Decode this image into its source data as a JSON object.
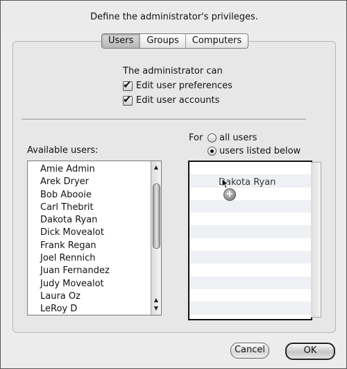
{
  "dialog": {
    "title": "Define the administrator's privileges."
  },
  "tabs": [
    {
      "label": "Users",
      "selected": true
    },
    {
      "label": "Groups",
      "selected": false
    },
    {
      "label": "Computers",
      "selected": false
    }
  ],
  "privileges": {
    "heading": "The administrator can",
    "options": [
      {
        "label": "Edit user preferences",
        "checked": true
      },
      {
        "label": "Edit user accounts",
        "checked": true
      }
    ]
  },
  "scope": {
    "label": "For",
    "options": [
      {
        "label": "all users",
        "selected": false
      },
      {
        "label": "users listed below",
        "selected": true
      }
    ]
  },
  "available_users": {
    "label": "Available users:",
    "items": [
      "Amie Admin",
      "Arek Dryer",
      "Bob Abooie",
      "Carl Thebrit",
      "Dakota Ryan",
      "Dick Movealot",
      "Frank Regan",
      "Joel Rennich",
      "Juan Fernandez",
      "Judy Movealot",
      "Laura Oz",
      "LeRoy D"
    ]
  },
  "listed_users": {
    "dragging_item": "Dakota Ryan",
    "drop_badge": "+"
  },
  "buttons": {
    "cancel": "Cancel",
    "ok": "OK"
  },
  "icons": {
    "cursor": "pointer-cursor-icon",
    "badge": "plus-badge-icon"
  }
}
